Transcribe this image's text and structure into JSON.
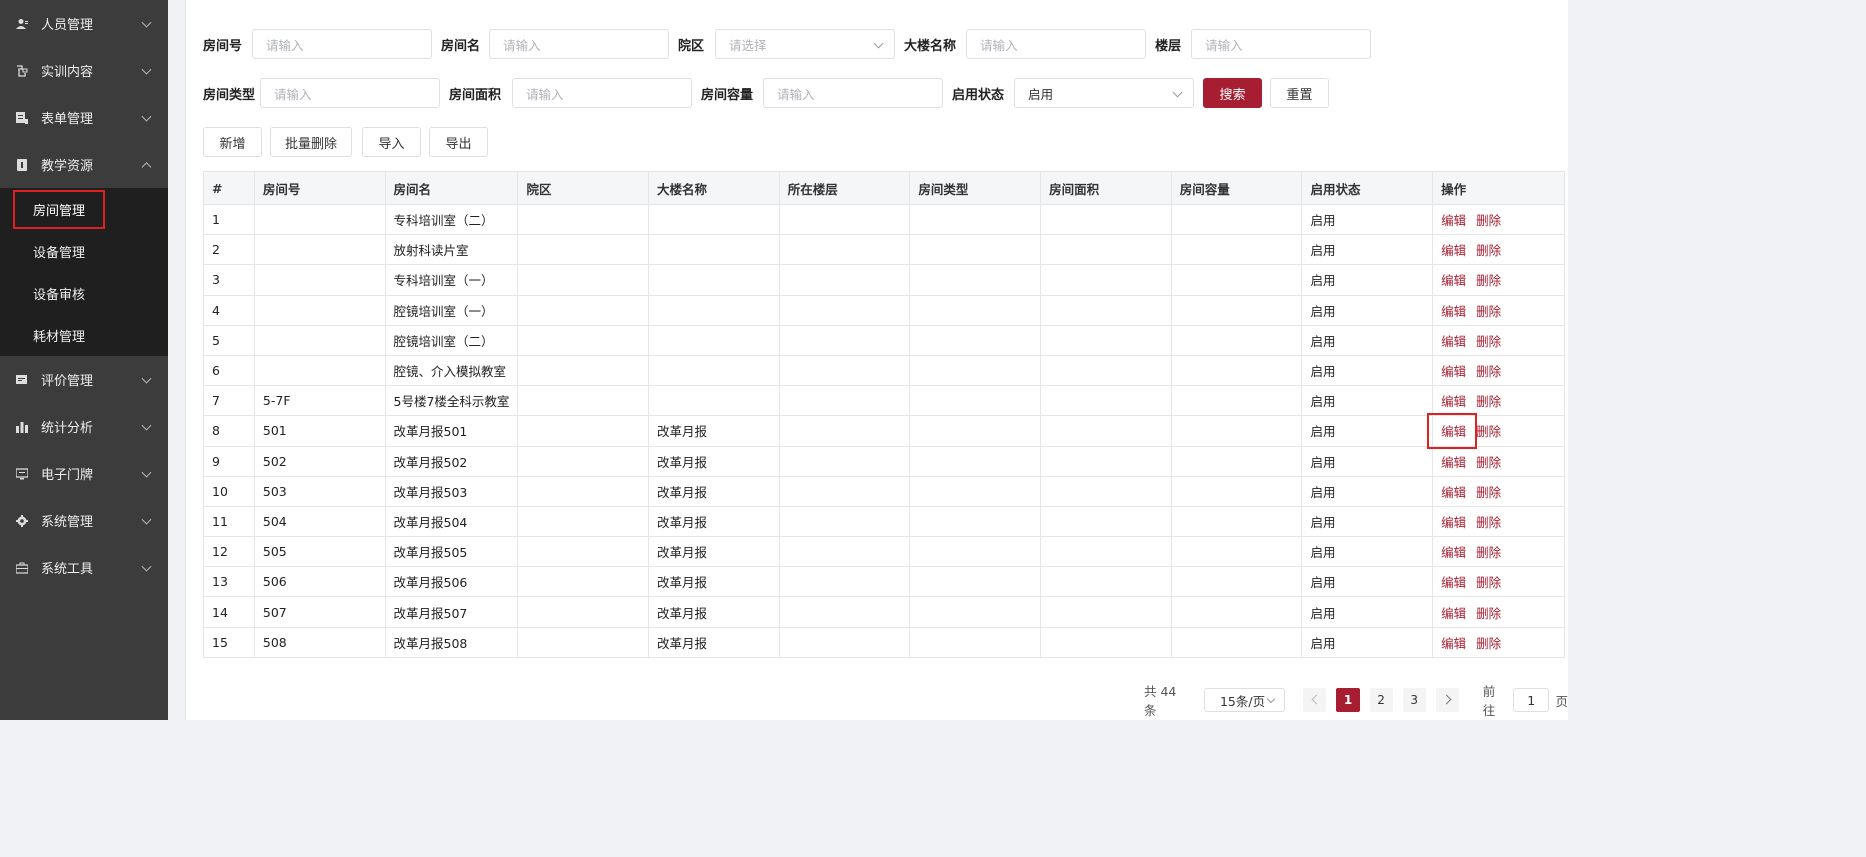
{
  "sidebar": {
    "items": [
      {
        "label": "人员管理",
        "icon": "user-icon"
      },
      {
        "label": "实训内容",
        "icon": "content-icon"
      },
      {
        "label": "表单管理",
        "icon": "form-icon"
      },
      {
        "label": "教学资源",
        "icon": "resource-icon",
        "expanded": true
      },
      {
        "label": "评价管理",
        "icon": "evaluate-icon"
      },
      {
        "label": "统计分析",
        "icon": "bar-chart-icon"
      },
      {
        "label": "电子门牌",
        "icon": "monitor-icon"
      },
      {
        "label": "系统管理",
        "icon": "gear-icon"
      },
      {
        "label": "系统工具",
        "icon": "toolbox-icon"
      }
    ],
    "submenu": [
      {
        "label": "房间管理",
        "active": true
      },
      {
        "label": "设备管理"
      },
      {
        "label": "设备审核"
      },
      {
        "label": "耗材管理"
      }
    ]
  },
  "filters": {
    "room_no": {
      "label": "房间号",
      "placeholder": "请输入"
    },
    "room_name": {
      "label": "房间名",
      "placeholder": "请输入"
    },
    "campus": {
      "label": "院区",
      "placeholder": "请选择"
    },
    "building": {
      "label": "大楼名称",
      "placeholder": "请输入"
    },
    "floor": {
      "label": "楼层",
      "placeholder": "请输入"
    },
    "room_type": {
      "label": "房间类型",
      "placeholder": "请输入"
    },
    "area": {
      "label": "房间面积",
      "placeholder": "请输入"
    },
    "capacity": {
      "label": "房间容量",
      "placeholder": "请输入"
    },
    "status": {
      "label": "启用状态",
      "value": "启用"
    },
    "search_label": "搜索",
    "reset_label": "重置"
  },
  "toolbar": {
    "add_label": "新增",
    "batch_delete_label": "批量删除",
    "import_label": "导入",
    "export_label": "导出"
  },
  "table": {
    "headers": [
      "#",
      "房间号",
      "房间名",
      "院区",
      "大楼名称",
      "所在楼层",
      "房间类型",
      "房间面积",
      "房间容量",
      "启用状态",
      "操作"
    ],
    "edit_label": "编辑",
    "delete_label": "删除",
    "rows": [
      [
        "1",
        "",
        "专科培训室（二）",
        "",
        "",
        "",
        "",
        "",
        "",
        "启用"
      ],
      [
        "2",
        "",
        "放射科读片室",
        "",
        "",
        "",
        "",
        "",
        "",
        "启用"
      ],
      [
        "3",
        "",
        "专科培训室（一）",
        "",
        "",
        "",
        "",
        "",
        "",
        "启用"
      ],
      [
        "4",
        "",
        "腔镜培训室（一）",
        "",
        "",
        "",
        "",
        "",
        "",
        "启用"
      ],
      [
        "5",
        "",
        "腔镜培训室（二）",
        "",
        "",
        "",
        "",
        "",
        "",
        "启用"
      ],
      [
        "6",
        "",
        "腔镜、介入模拟教室",
        "",
        "",
        "",
        "",
        "",
        "",
        "启用"
      ],
      [
        "7",
        "5-7F",
        "5号楼7楼全科示教室",
        "",
        "",
        "",
        "",
        "",
        "",
        "启用"
      ],
      [
        "8",
        "501",
        "改革月报501",
        "",
        "改革月报",
        "",
        "",
        "",
        "",
        "启用"
      ],
      [
        "9",
        "502",
        "改革月报502",
        "",
        "改革月报",
        "",
        "",
        "",
        "",
        "启用"
      ],
      [
        "10",
        "503",
        "改革月报503",
        "",
        "改革月报",
        "",
        "",
        "",
        "",
        "启用"
      ],
      [
        "11",
        "504",
        "改革月报504",
        "",
        "改革月报",
        "",
        "",
        "",
        "",
        "启用"
      ],
      [
        "12",
        "505",
        "改革月报505",
        "",
        "改革月报",
        "",
        "",
        "",
        "",
        "启用"
      ],
      [
        "13",
        "506",
        "改革月报506",
        "",
        "改革月报",
        "",
        "",
        "",
        "",
        "启用"
      ],
      [
        "14",
        "507",
        "改革月报507",
        "",
        "改革月报",
        "",
        "",
        "",
        "",
        "启用"
      ],
      [
        "15",
        "508",
        "改革月报508",
        "",
        "改革月报",
        "",
        "",
        "",
        "",
        "启用"
      ]
    ]
  },
  "pagination": {
    "total_text": "共 44 条",
    "page_size": "15条/页",
    "pages": [
      "1",
      "2",
      "3"
    ],
    "current": "1",
    "goto_prefix": "前往",
    "goto_value": "1",
    "goto_suffix": "页"
  },
  "colors": {
    "accent": "#a71d31",
    "sidebar_bg": "#3c3c3c",
    "submenu_bg": "#1f1f1f",
    "highlight": "#e02020"
  }
}
